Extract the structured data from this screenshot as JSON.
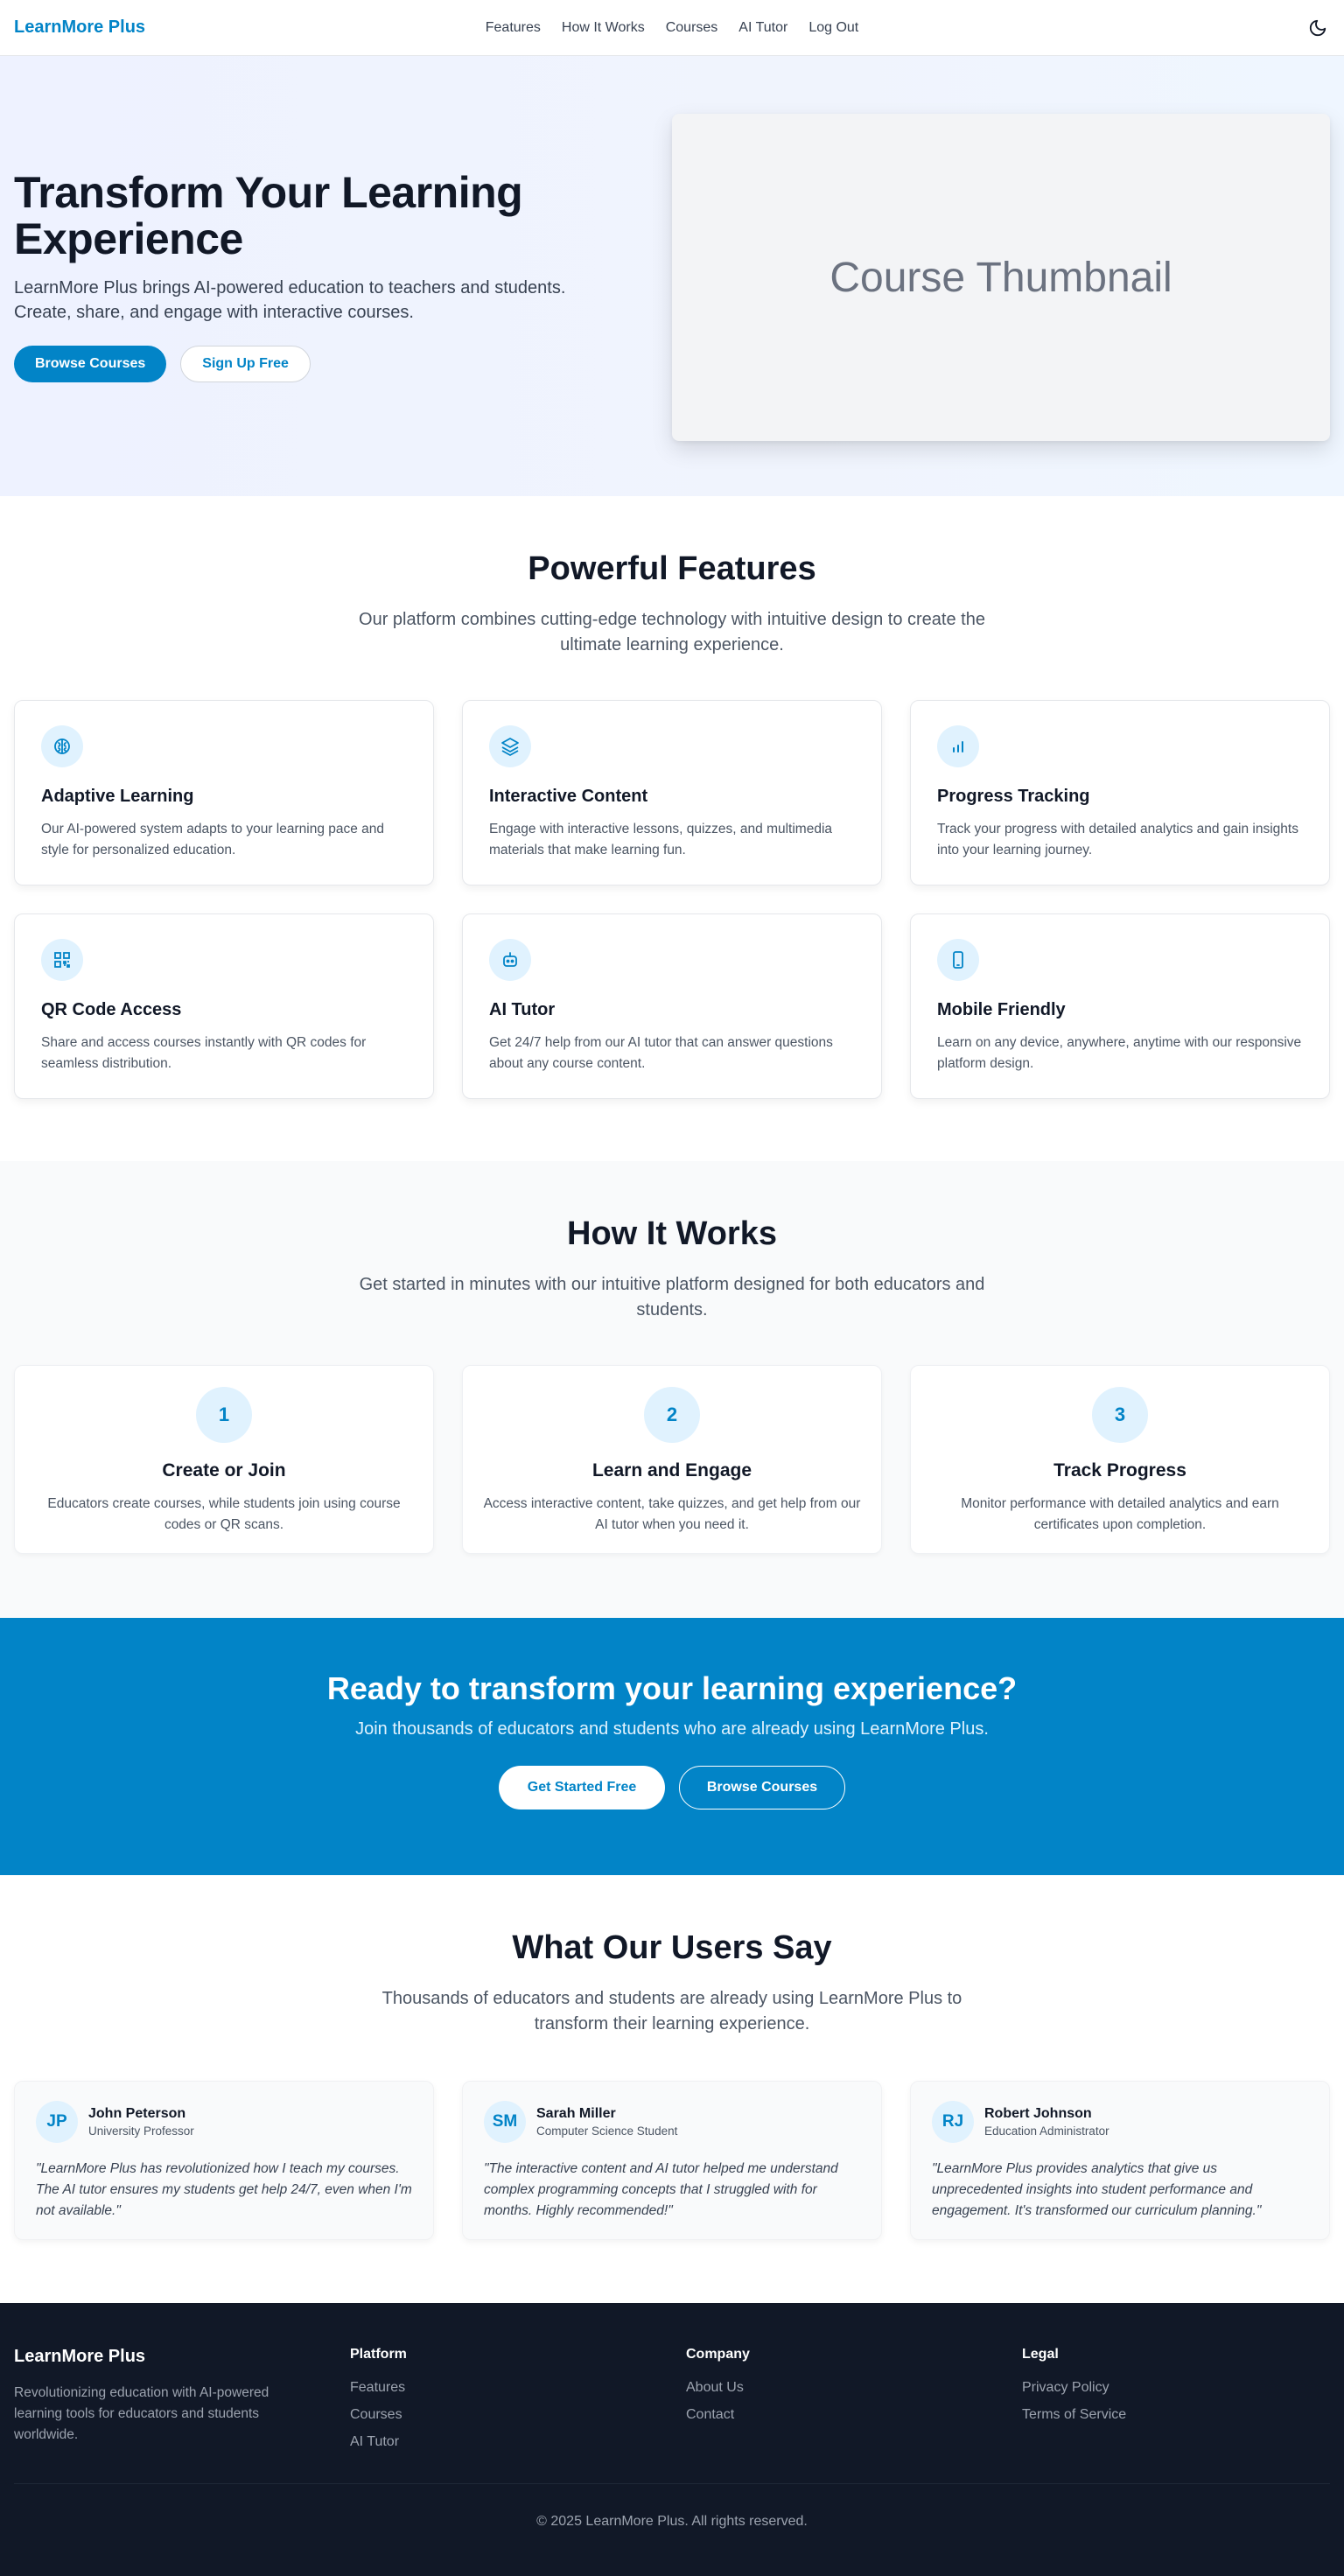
{
  "nav": {
    "brand": "LearnMore Plus",
    "links": [
      "Features",
      "How It Works",
      "Courses",
      "AI Tutor",
      "Log Out"
    ],
    "theme_icon": "moon-icon"
  },
  "hero": {
    "title": "Transform Your Learning Experience",
    "subtitle": "LearnMore Plus brings AI-powered education to teachers and students. Create, share, and engage with interactive courses.",
    "primary_button": "Browse Courses",
    "secondary_button": "Sign Up Free",
    "thumbnail_label": "Course Thumbnail"
  },
  "features": {
    "title": "Powerful Features",
    "subtitle": "Our platform combines cutting-edge technology with intuitive design to create the ultimate learning experience.",
    "items": [
      {
        "icon": "brain-icon",
        "title": "Adaptive Learning",
        "text": "Our AI-powered system adapts to your learning pace and style for personalized education."
      },
      {
        "icon": "layers-icon",
        "title": "Interactive Content",
        "text": "Engage with interactive lessons, quizzes, and multimedia materials that make learning fun."
      },
      {
        "icon": "bar-chart-icon",
        "title": "Progress Tracking",
        "text": "Track your progress with detailed analytics and gain insights into your learning journey."
      },
      {
        "icon": "qr-code-icon",
        "title": "QR Code Access",
        "text": "Share and access courses instantly with QR codes for seamless distribution."
      },
      {
        "icon": "robot-icon",
        "title": "AI Tutor",
        "text": "Get 24/7 help from our AI tutor that can answer questions about any course content."
      },
      {
        "icon": "mobile-icon",
        "title": "Mobile Friendly",
        "text": "Learn on any device, anywhere, anytime with our responsive platform design."
      }
    ]
  },
  "how": {
    "title": "How It Works",
    "subtitle": "Get started in minutes with our intuitive platform designed for both educators and students.",
    "steps": [
      {
        "num": "1",
        "title": "Create or Join",
        "text": "Educators create courses, while students join using course codes or QR scans."
      },
      {
        "num": "2",
        "title": "Learn and Engage",
        "text": "Access interactive content, take quizzes, and get help from our AI tutor when you need it."
      },
      {
        "num": "3",
        "title": "Track Progress",
        "text": "Monitor performance with detailed analytics and earn certificates upon completion."
      }
    ]
  },
  "cta": {
    "title": "Ready to transform your learning experience?",
    "subtitle": "Join thousands of educators and students who are already using LearnMore Plus.",
    "primary_button": "Get Started Free",
    "secondary_button": "Browse Courses"
  },
  "testimonials": {
    "title": "What Our Users Say",
    "subtitle": "Thousands of educators and students are already using LearnMore Plus to transform their learning experience.",
    "items": [
      {
        "initials": "JP",
        "name": "John Peterson",
        "role": "University Professor",
        "quote": "\"LearnMore Plus has revolutionized how I teach my courses. The AI tutor ensures my students get help 24/7, even when I'm not available.\""
      },
      {
        "initials": "SM",
        "name": "Sarah Miller",
        "role": "Computer Science Student",
        "quote": "\"The interactive content and AI tutor helped me understand complex programming concepts that I struggled with for months. Highly recommended!\""
      },
      {
        "initials": "RJ",
        "name": "Robert Johnson",
        "role": "Education Administrator",
        "quote": "\"LearnMore Plus provides analytics that give us unprecedented insights into student performance and engagement. It's transformed our curriculum planning.\""
      }
    ]
  },
  "footer": {
    "brand": "LearnMore Plus",
    "description": "Revolutionizing education with AI-powered learning tools for educators and students worldwide.",
    "platform": {
      "heading": "Platform",
      "links": [
        "Features",
        "Courses",
        "AI Tutor"
      ]
    },
    "company": {
      "heading": "Company",
      "links": [
        "About Us",
        "Contact"
      ]
    },
    "legal": {
      "heading": "Legal",
      "links": [
        "Privacy Policy",
        "Terms of Service"
      ]
    },
    "copyright": "© 2025 LearnMore Plus. All rights reserved."
  },
  "colors": {
    "brand": "#0284c7",
    "footer_bg": "#111827",
    "icon_bg": "#e0f2fe"
  }
}
